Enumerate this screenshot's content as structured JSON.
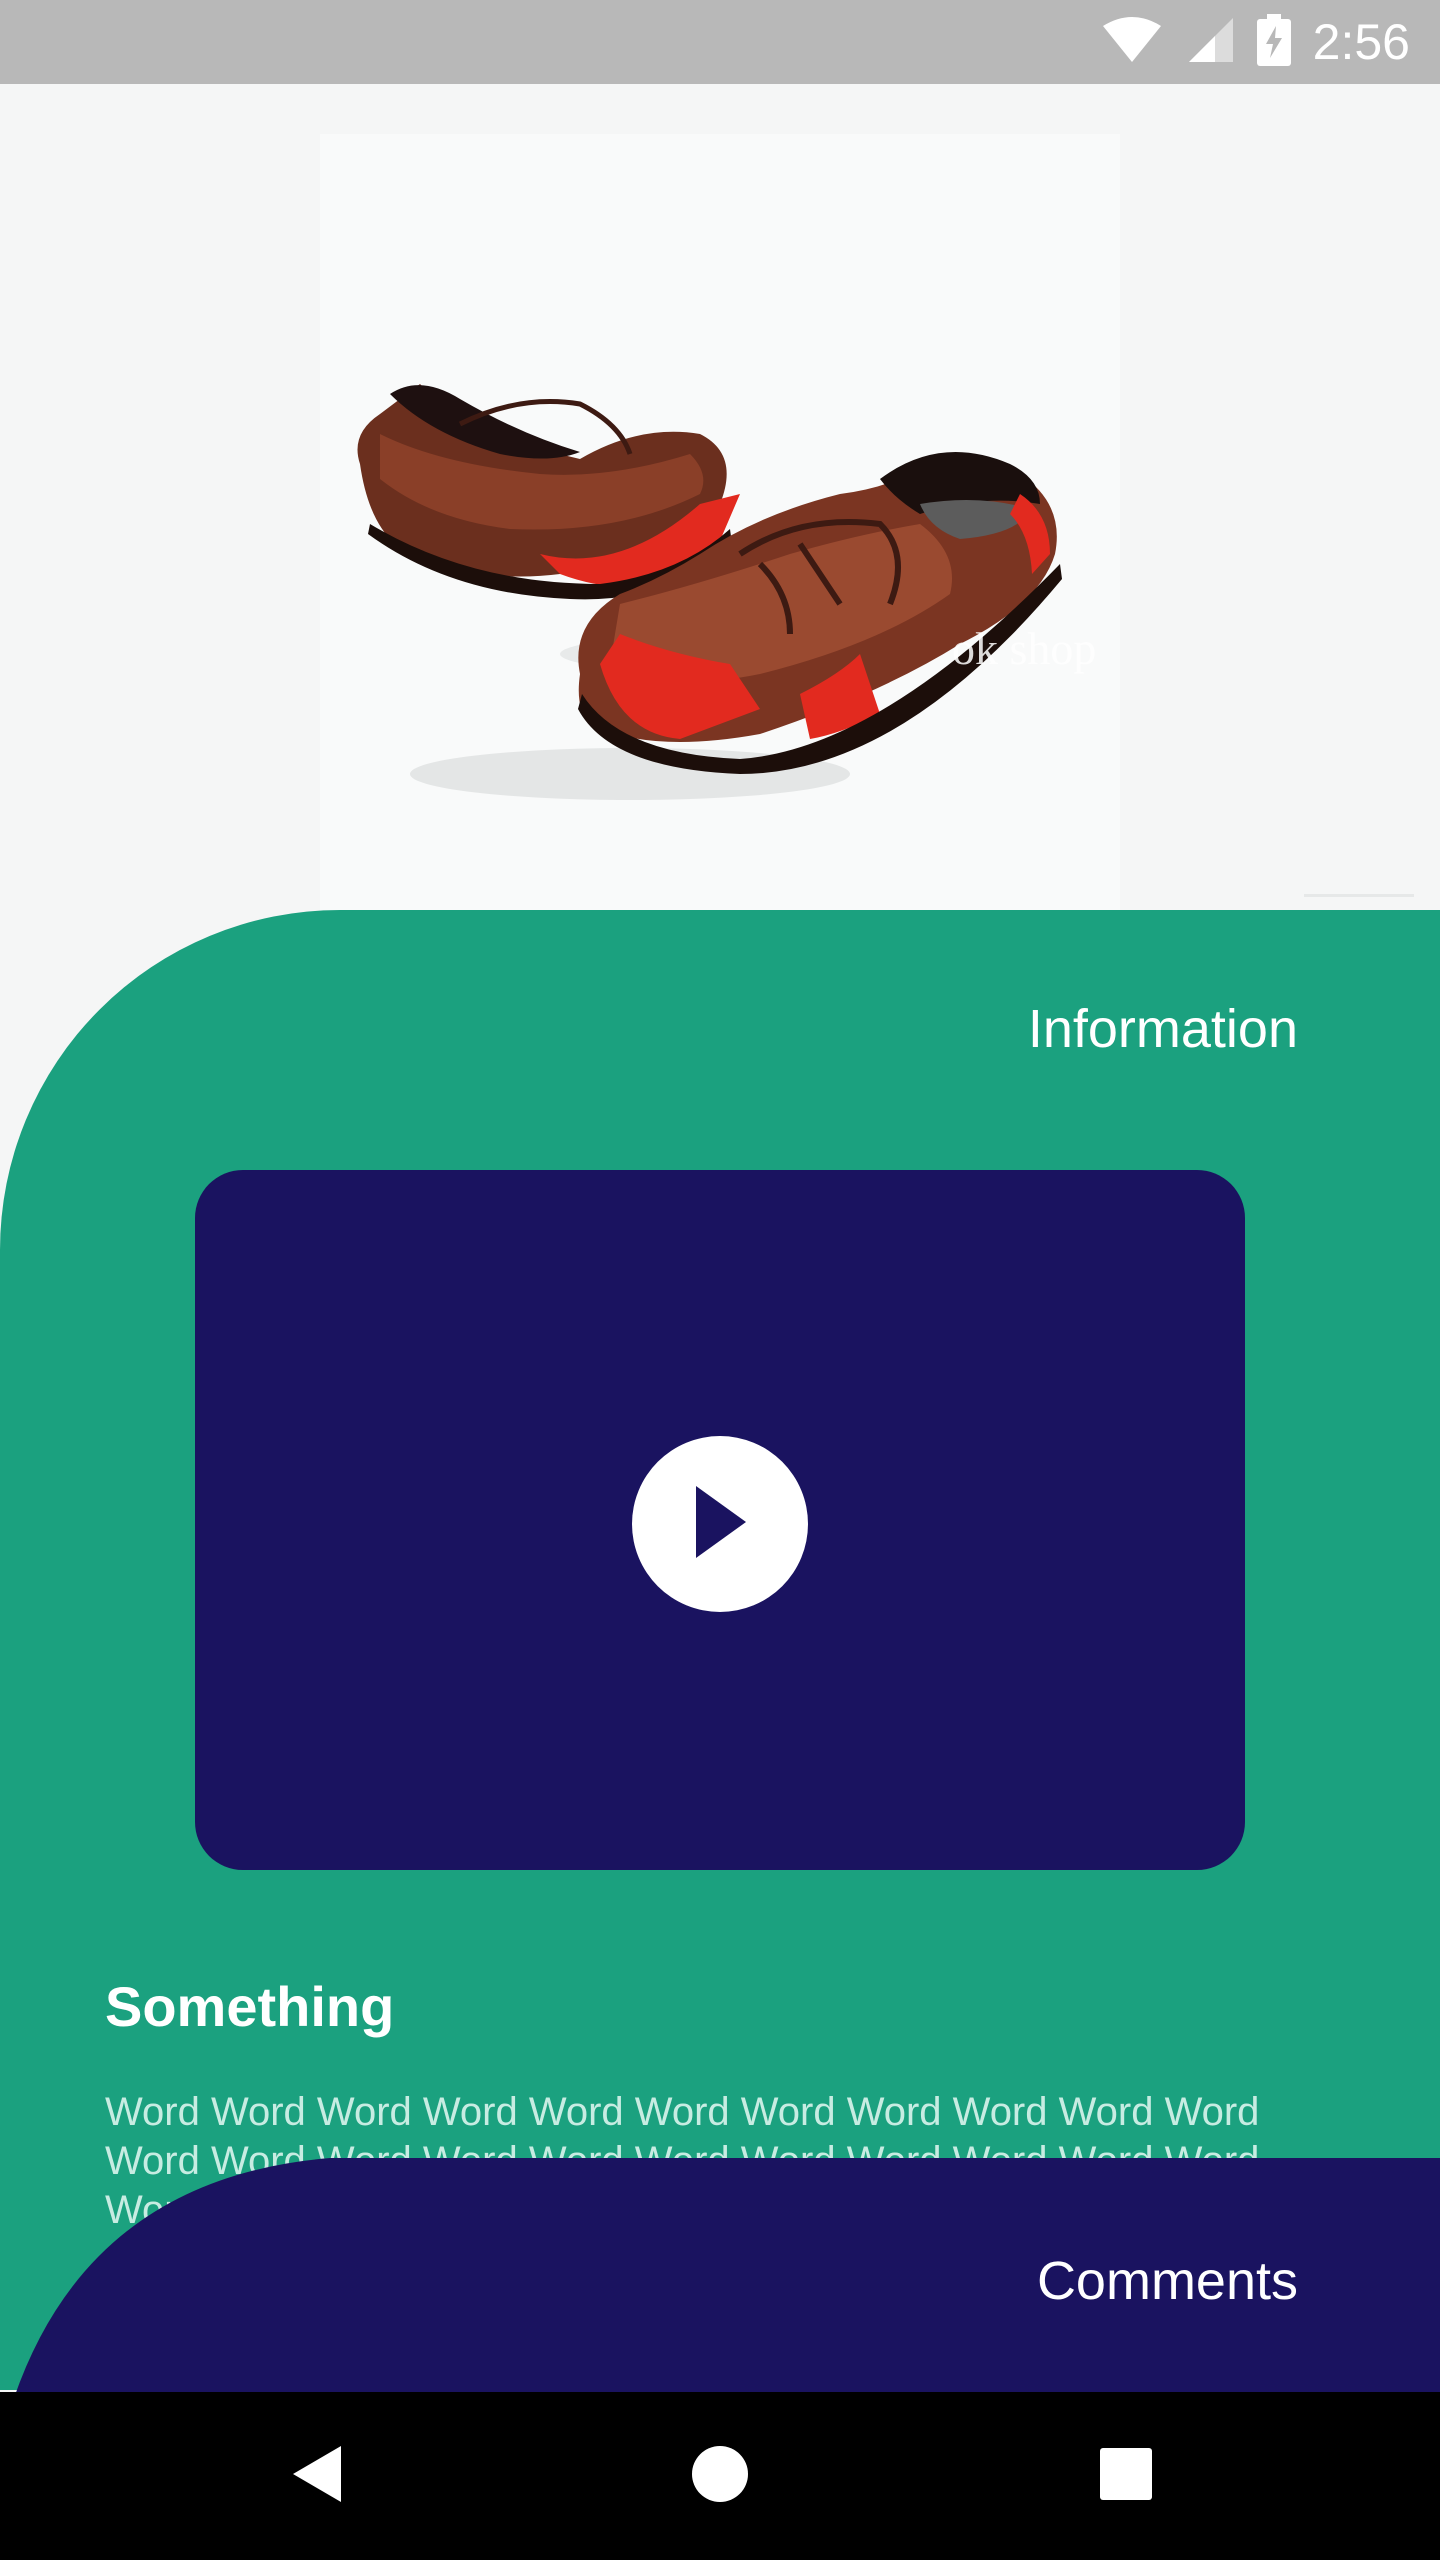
{
  "status_bar": {
    "time": "2:56",
    "icons": [
      "wifi-icon",
      "signal-icon",
      "battery-charging-icon"
    ]
  },
  "hero": {
    "image_alt": "brown leather loafers with red heel accents",
    "watermark": "ok shop"
  },
  "information": {
    "title": "Information",
    "video": {
      "play_icon": "play-icon"
    },
    "heading": "Something",
    "body": "Word Word Word Word Word Word Word Word Word Word Word Word Word Word Word Word Word Word Word Word Word Word Word Word Word Word Word Word Word Word Word Word Word"
  },
  "comments": {
    "title": "Comments"
  },
  "nav_bar": {
    "icons": [
      "back-icon",
      "home-icon",
      "recents-icon"
    ]
  },
  "colors": {
    "status_bar": "#b8b8b8",
    "background": "#f5f6f6",
    "teal": "#1ba17f",
    "navy": "#1a1360",
    "text_muted": "#c7ece2"
  }
}
